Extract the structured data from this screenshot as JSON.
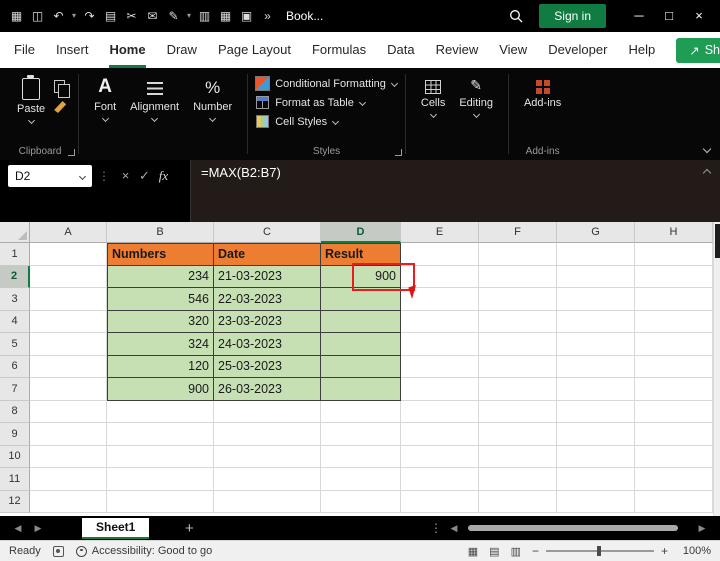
{
  "colors": {
    "accent_green": "#107C41",
    "share_green": "#1F9D55",
    "header_orange": "#ED7D31",
    "cell_green": "#C6E0B4",
    "annotation_red": "#EA1C1C"
  },
  "titlebar": {
    "doc_title": "Book...",
    "sign_in_label": "Sign in",
    "overflow_glyph": "»",
    "icons": [
      {
        "name": "app-launcher-icon",
        "glyph": "▦"
      },
      {
        "name": "save-icon",
        "glyph": "◫"
      },
      {
        "name": "undo-icon",
        "glyph": "↶"
      },
      {
        "name": "undo-dropdown-icon",
        "glyph": "▾"
      },
      {
        "name": "redo-icon",
        "glyph": "↷"
      },
      {
        "name": "paste-board-icon",
        "glyph": "▤"
      },
      {
        "name": "cut-icon",
        "glyph": "✂"
      },
      {
        "name": "mail-icon",
        "glyph": "✉"
      },
      {
        "name": "pen-icon",
        "glyph": "✎"
      },
      {
        "name": "dropdown-icon",
        "glyph": "▾"
      },
      {
        "name": "printer-icon",
        "glyph": "▥"
      },
      {
        "name": "grid-icon",
        "glyph": "▦"
      },
      {
        "name": "window-icon",
        "glyph": "▣"
      }
    ],
    "window": {
      "minimize": "─",
      "maximize": "□",
      "close": "×"
    }
  },
  "menubar": {
    "tabs": [
      "File",
      "Insert",
      "Home",
      "Draw",
      "Page Layout",
      "Formulas",
      "Data",
      "Review",
      "View",
      "Developer",
      "Help"
    ],
    "active_tab": "Home",
    "share_label": "Share",
    "share_icon_glyph": "↗"
  },
  "ribbon": {
    "paste_label": "Paste",
    "font_label": "Font",
    "alignment_label": "Alignment",
    "number_label": "Number",
    "styles_items": [
      "Conditional Formatting",
      "Format as Table",
      "Cell Styles"
    ],
    "cells_label": "Cells",
    "editing_label": "Editing",
    "editing_icon_glyph": "✎",
    "addins_label": "Add-ins",
    "group_labels": {
      "clipboard": "Clipboard",
      "styles": "Styles",
      "addins": "Add-ins"
    }
  },
  "formula_bar": {
    "name_box": "D2",
    "dots_glyph": "⋮",
    "cancel_glyph": "×",
    "enter_glyph": "✓",
    "fx_label": "fx",
    "formula": "=MAX(B2:B7)"
  },
  "grid": {
    "column_headers": [
      "A",
      "B",
      "C",
      "D",
      "E",
      "F",
      "G",
      "H"
    ],
    "row_headers": [
      "1",
      "2",
      "3",
      "4",
      "5",
      "6",
      "7",
      "8",
      "9",
      "10",
      "11",
      "12"
    ],
    "selected_column": "D",
    "selected_row": "2",
    "active_cell": "D2"
  },
  "table": {
    "headers": {
      "numbers": "Numbers",
      "date": "Date",
      "result": "Result"
    },
    "rows": [
      {
        "number": "234",
        "date": "21-03-2023",
        "result": "900"
      },
      {
        "number": "546",
        "date": "22-03-2023",
        "result": ""
      },
      {
        "number": "320",
        "date": "23-03-2023",
        "result": ""
      },
      {
        "number": "324",
        "date": "24-03-2023",
        "result": ""
      },
      {
        "number": "120",
        "date": "25-03-2023",
        "result": ""
      },
      {
        "number": "900",
        "date": "26-03-2023",
        "result": ""
      }
    ]
  },
  "sheet_tabs": {
    "tabs": [
      "Sheet1"
    ],
    "add_glyph": "+",
    "left_arrow": "◀",
    "right_arrow": "▶",
    "menu_glyph": "⋮"
  },
  "status_bar": {
    "mode": "Ready",
    "accessibility": "Accessibility: Good to go",
    "view_icons": [
      {
        "name": "normal-view-icon",
        "glyph": "▦"
      },
      {
        "name": "page-layout-view-icon",
        "glyph": "▤"
      },
      {
        "name": "page-break-view-icon",
        "glyph": "▥"
      }
    ],
    "zoom_out": "−",
    "zoom_in": "+",
    "zoom_level": "100%"
  }
}
